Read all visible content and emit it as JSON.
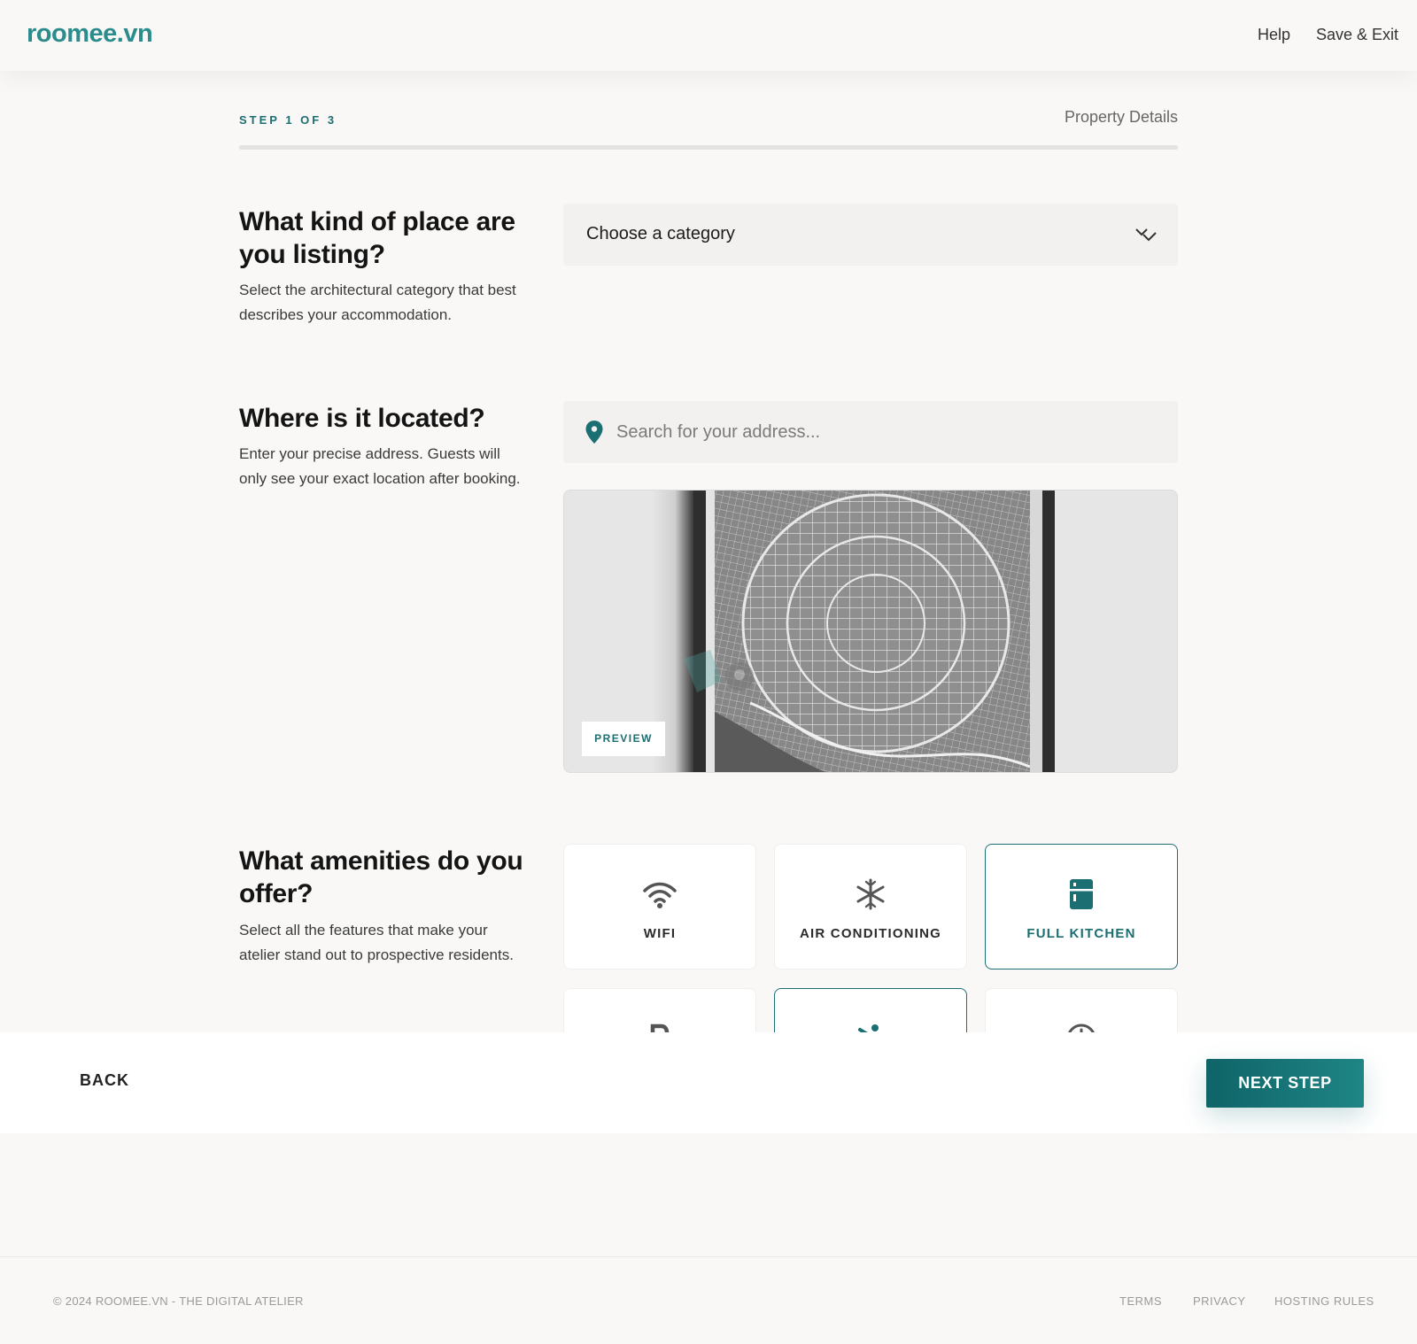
{
  "header": {
    "logo": "roomee.vn",
    "nav": {
      "help": "Help",
      "save_exit": "Save & Exit"
    }
  },
  "progress": {
    "step_label": "STEP 1 OF 3",
    "step_title": "Property Details",
    "current_step": 1,
    "total_steps": 3,
    "fill_fraction": 0.0
  },
  "sections": {
    "category": {
      "heading": "What kind of place are you listing?",
      "description": "Select the architectural category that best describes your accommodation.",
      "select_value": "Choose a category"
    },
    "location": {
      "heading": "Where is it located?",
      "description": "Enter your precise address. Guests will only see your exact location after booking.",
      "search_placeholder": "Search for your address...",
      "map_badge": "PREVIEW"
    },
    "amenities": {
      "heading": "What amenities do you offer?",
      "description": "Select all the features that make your atelier stand out to prospective residents.",
      "items": [
        {
          "label": "WIFI",
          "icon": "wifi-icon",
          "selected": false
        },
        {
          "label": "AIR CONDITIONING",
          "icon": "snowflake-icon",
          "selected": false
        },
        {
          "label": "FULL KITCHEN",
          "icon": "kitchen-icon",
          "selected": true
        },
        {
          "label": "",
          "icon": "parking-icon",
          "selected": false
        },
        {
          "label": "",
          "icon": "pool-icon",
          "selected": true
        },
        {
          "label": "",
          "icon": "clock-icon",
          "selected": false
        }
      ]
    }
  },
  "actions": {
    "back": "BACK",
    "next": "NEXT STEP"
  },
  "footer": {
    "copyright": "© 2024 ROOMEE.VN - THE DIGITAL ATELIER",
    "links": {
      "terms": "TERMS",
      "privacy": "PRIVACY",
      "hosting_rules": "HOSTING RULES"
    }
  },
  "colors": {
    "accent": "#1b6e72",
    "logo": "#2a8c8c",
    "background": "#f9f8f6"
  }
}
